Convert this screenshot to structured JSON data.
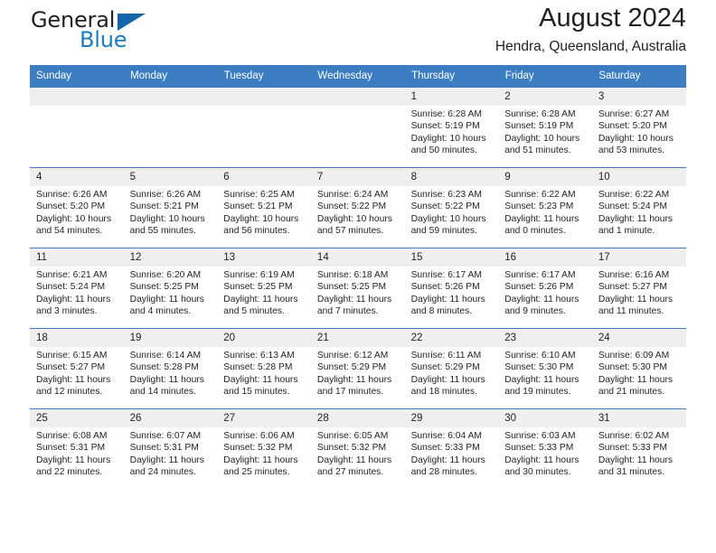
{
  "brand": {
    "name_part1": "General",
    "name_part2": "Blue",
    "logo_icon": "triangle-flag-icon"
  },
  "header": {
    "title": "August 2024",
    "subtitle": "Hendra, Queensland, Australia"
  },
  "calendar": {
    "weekday_headers": [
      "Sunday",
      "Monday",
      "Tuesday",
      "Wednesday",
      "Thursday",
      "Friday",
      "Saturday"
    ],
    "colors": {
      "header_blue": "#3b7dc0",
      "daynum_gray": "#efefef",
      "brand_blue": "#1a7dc4",
      "text": "#231f20"
    },
    "weeks": [
      [
        {
          "day": "",
          "sunrise": "",
          "sunset": "",
          "daylight1": "",
          "daylight2": ""
        },
        {
          "day": "",
          "sunrise": "",
          "sunset": "",
          "daylight1": "",
          "daylight2": ""
        },
        {
          "day": "",
          "sunrise": "",
          "sunset": "",
          "daylight1": "",
          "daylight2": ""
        },
        {
          "day": "",
          "sunrise": "",
          "sunset": "",
          "daylight1": "",
          "daylight2": ""
        },
        {
          "day": "1",
          "sunrise": "Sunrise: 6:28 AM",
          "sunset": "Sunset: 5:19 PM",
          "daylight1": "Daylight: 10 hours",
          "daylight2": "and 50 minutes."
        },
        {
          "day": "2",
          "sunrise": "Sunrise: 6:28 AM",
          "sunset": "Sunset: 5:19 PM",
          "daylight1": "Daylight: 10 hours",
          "daylight2": "and 51 minutes."
        },
        {
          "day": "3",
          "sunrise": "Sunrise: 6:27 AM",
          "sunset": "Sunset: 5:20 PM",
          "daylight1": "Daylight: 10 hours",
          "daylight2": "and 53 minutes."
        }
      ],
      [
        {
          "day": "4",
          "sunrise": "Sunrise: 6:26 AM",
          "sunset": "Sunset: 5:20 PM",
          "daylight1": "Daylight: 10 hours",
          "daylight2": "and 54 minutes."
        },
        {
          "day": "5",
          "sunrise": "Sunrise: 6:26 AM",
          "sunset": "Sunset: 5:21 PM",
          "daylight1": "Daylight: 10 hours",
          "daylight2": "and 55 minutes."
        },
        {
          "day": "6",
          "sunrise": "Sunrise: 6:25 AM",
          "sunset": "Sunset: 5:21 PM",
          "daylight1": "Daylight: 10 hours",
          "daylight2": "and 56 minutes."
        },
        {
          "day": "7",
          "sunrise": "Sunrise: 6:24 AM",
          "sunset": "Sunset: 5:22 PM",
          "daylight1": "Daylight: 10 hours",
          "daylight2": "and 57 minutes."
        },
        {
          "day": "8",
          "sunrise": "Sunrise: 6:23 AM",
          "sunset": "Sunset: 5:22 PM",
          "daylight1": "Daylight: 10 hours",
          "daylight2": "and 59 minutes."
        },
        {
          "day": "9",
          "sunrise": "Sunrise: 6:22 AM",
          "sunset": "Sunset: 5:23 PM",
          "daylight1": "Daylight: 11 hours",
          "daylight2": "and 0 minutes."
        },
        {
          "day": "10",
          "sunrise": "Sunrise: 6:22 AM",
          "sunset": "Sunset: 5:24 PM",
          "daylight1": "Daylight: 11 hours",
          "daylight2": "and 1 minute."
        }
      ],
      [
        {
          "day": "11",
          "sunrise": "Sunrise: 6:21 AM",
          "sunset": "Sunset: 5:24 PM",
          "daylight1": "Daylight: 11 hours",
          "daylight2": "and 3 minutes."
        },
        {
          "day": "12",
          "sunrise": "Sunrise: 6:20 AM",
          "sunset": "Sunset: 5:25 PM",
          "daylight1": "Daylight: 11 hours",
          "daylight2": "and 4 minutes."
        },
        {
          "day": "13",
          "sunrise": "Sunrise: 6:19 AM",
          "sunset": "Sunset: 5:25 PM",
          "daylight1": "Daylight: 11 hours",
          "daylight2": "and 5 minutes."
        },
        {
          "day": "14",
          "sunrise": "Sunrise: 6:18 AM",
          "sunset": "Sunset: 5:25 PM",
          "daylight1": "Daylight: 11 hours",
          "daylight2": "and 7 minutes."
        },
        {
          "day": "15",
          "sunrise": "Sunrise: 6:17 AM",
          "sunset": "Sunset: 5:26 PM",
          "daylight1": "Daylight: 11 hours",
          "daylight2": "and 8 minutes."
        },
        {
          "day": "16",
          "sunrise": "Sunrise: 6:17 AM",
          "sunset": "Sunset: 5:26 PM",
          "daylight1": "Daylight: 11 hours",
          "daylight2": "and 9 minutes."
        },
        {
          "day": "17",
          "sunrise": "Sunrise: 6:16 AM",
          "sunset": "Sunset: 5:27 PM",
          "daylight1": "Daylight: 11 hours",
          "daylight2": "and 11 minutes."
        }
      ],
      [
        {
          "day": "18",
          "sunrise": "Sunrise: 6:15 AM",
          "sunset": "Sunset: 5:27 PM",
          "daylight1": "Daylight: 11 hours",
          "daylight2": "and 12 minutes."
        },
        {
          "day": "19",
          "sunrise": "Sunrise: 6:14 AM",
          "sunset": "Sunset: 5:28 PM",
          "daylight1": "Daylight: 11 hours",
          "daylight2": "and 14 minutes."
        },
        {
          "day": "20",
          "sunrise": "Sunrise: 6:13 AM",
          "sunset": "Sunset: 5:28 PM",
          "daylight1": "Daylight: 11 hours",
          "daylight2": "and 15 minutes."
        },
        {
          "day": "21",
          "sunrise": "Sunrise: 6:12 AM",
          "sunset": "Sunset: 5:29 PM",
          "daylight1": "Daylight: 11 hours",
          "daylight2": "and 17 minutes."
        },
        {
          "day": "22",
          "sunrise": "Sunrise: 6:11 AM",
          "sunset": "Sunset: 5:29 PM",
          "daylight1": "Daylight: 11 hours",
          "daylight2": "and 18 minutes."
        },
        {
          "day": "23",
          "sunrise": "Sunrise: 6:10 AM",
          "sunset": "Sunset: 5:30 PM",
          "daylight1": "Daylight: 11 hours",
          "daylight2": "and 19 minutes."
        },
        {
          "day": "24",
          "sunrise": "Sunrise: 6:09 AM",
          "sunset": "Sunset: 5:30 PM",
          "daylight1": "Daylight: 11 hours",
          "daylight2": "and 21 minutes."
        }
      ],
      [
        {
          "day": "25",
          "sunrise": "Sunrise: 6:08 AM",
          "sunset": "Sunset: 5:31 PM",
          "daylight1": "Daylight: 11 hours",
          "daylight2": "and 22 minutes."
        },
        {
          "day": "26",
          "sunrise": "Sunrise: 6:07 AM",
          "sunset": "Sunset: 5:31 PM",
          "daylight1": "Daylight: 11 hours",
          "daylight2": "and 24 minutes."
        },
        {
          "day": "27",
          "sunrise": "Sunrise: 6:06 AM",
          "sunset": "Sunset: 5:32 PM",
          "daylight1": "Daylight: 11 hours",
          "daylight2": "and 25 minutes."
        },
        {
          "day": "28",
          "sunrise": "Sunrise: 6:05 AM",
          "sunset": "Sunset: 5:32 PM",
          "daylight1": "Daylight: 11 hours",
          "daylight2": "and 27 minutes."
        },
        {
          "day": "29",
          "sunrise": "Sunrise: 6:04 AM",
          "sunset": "Sunset: 5:33 PM",
          "daylight1": "Daylight: 11 hours",
          "daylight2": "and 28 minutes."
        },
        {
          "day": "30",
          "sunrise": "Sunrise: 6:03 AM",
          "sunset": "Sunset: 5:33 PM",
          "daylight1": "Daylight: 11 hours",
          "daylight2": "and 30 minutes."
        },
        {
          "day": "31",
          "sunrise": "Sunrise: 6:02 AM",
          "sunset": "Sunset: 5:33 PM",
          "daylight1": "Daylight: 11 hours",
          "daylight2": "and 31 minutes."
        }
      ]
    ]
  }
}
